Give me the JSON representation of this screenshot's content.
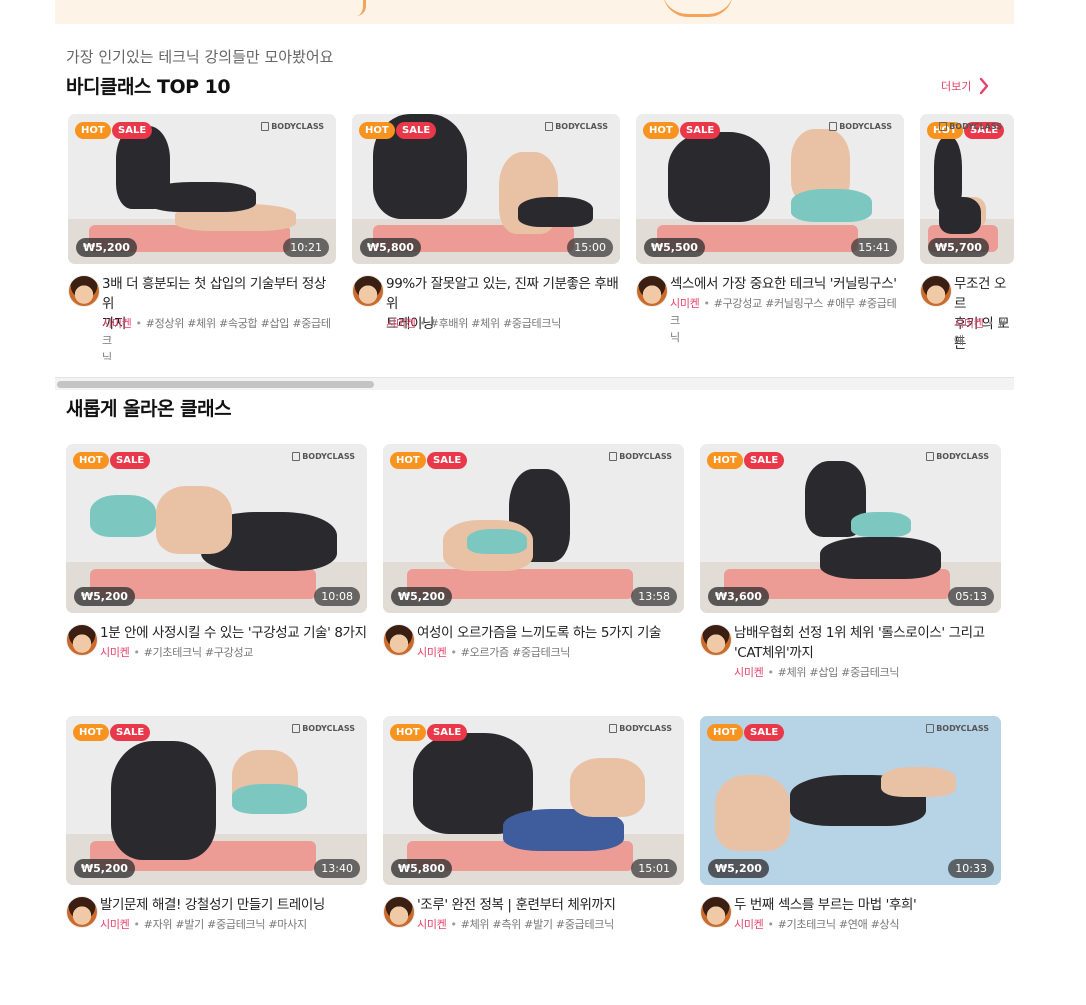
{
  "top10": {
    "subtitle": "가장 인기있는 테크닉 강의들만 모아봤어요",
    "title": "바디클래스 TOP 10",
    "more_label": "더보기"
  },
  "latest": {
    "title": "새롭게 올라온 클래스"
  },
  "badges": {
    "hot": "HOT",
    "sale": "SALE"
  },
  "brand_logo": "BODYCLASS",
  "colors": {
    "accent": "#e64168",
    "hot": "#f7931e",
    "sale": "#e8384a"
  },
  "top10_cards": [
    {
      "price": "₩5,200",
      "duration": "10:21",
      "title_lines": [
        "3배 더 흥분되는 첫 삽입의 기술부터 정상위",
        "까지"
      ],
      "author": "시미켄",
      "tags_lines": [
        "#정상위 #체위 #속궁합 #삽입 #중급테크",
        "닉"
      ]
    },
    {
      "price": "₩5,800",
      "duration": "15:00",
      "title_lines": [
        "99%가 잘못알고 있는, 진짜 기분좋은 후배위",
        "트레이닝"
      ],
      "author": "시미켄",
      "tags_lines": [
        "#후배위 #체위 #중급테크닉"
      ]
    },
    {
      "price": "₩5,500",
      "duration": "15:41",
      "title_lines": [
        "섹스에서 가장 중요한 테크닉 '커닐링구스'"
      ],
      "author": "시미켄",
      "tags_lines": [
        "#구강성교 #커닐링구스 #애무 #중급테크",
        "닉"
      ]
    },
    {
      "price": "₩5,700",
      "duration": "",
      "title_lines": [
        "무조건 오르",
        "후키'의 모든"
      ],
      "author": "시미켄",
      "tags_lines": [
        "#애"
      ]
    }
  ],
  "latest_cards": [
    {
      "price": "₩5,200",
      "duration": "10:08",
      "title_lines": [
        "1분 안에 사정시킬 수 있는 '구강성교 기술' 8가지"
      ],
      "author": "시미켄",
      "tags_lines": [
        "#기초테크닉 #구강성교"
      ]
    },
    {
      "price": "₩5,200",
      "duration": "13:58",
      "title_lines": [
        "여성이 오르가즘을 느끼도록 하는 5가지 기술"
      ],
      "author": "시미켄",
      "tags_lines": [
        "#오르가즘 #중급테크닉"
      ]
    },
    {
      "price": "₩3,600",
      "duration": "05:13",
      "title_lines": [
        "남배우협회 선정 1위 체위 '롤스로이스' 그리고",
        "'CAT체위'까지"
      ],
      "author": "시미켄",
      "tags_lines": [
        "#체위 #삽입 #중급테크닉"
      ]
    },
    {
      "price": "₩5,200",
      "duration": "13:40",
      "title_lines": [
        "발기문제 해결! 강철성기 만들기 트레이닝"
      ],
      "author": "시미켄",
      "tags_lines": [
        "#자위 #발기 #중급테크닉 #마사지"
      ]
    },
    {
      "price": "₩5,800",
      "duration": "15:01",
      "title_lines": [
        "'조루' 완전 정복 | 훈련부터 체위까지"
      ],
      "author": "시미켄",
      "tags_lines": [
        "#체위 #측위 #발기 #중급테크닉"
      ]
    },
    {
      "price": "₩5,200",
      "duration": "10:33",
      "title_lines": [
        "두 번째 섹스를 부르는 마법 '후희'"
      ],
      "author": "시미켄",
      "tags_lines": [
        "#기초테크닉 #연애 #상식"
      ]
    }
  ]
}
